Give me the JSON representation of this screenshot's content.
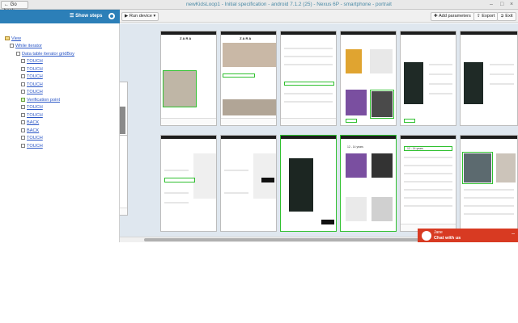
{
  "window": {
    "back_label": "Go back",
    "title": "newKidsLoop1 - Initial specification - android 7.1.2 (25) - Nexus 6P - smartphone - portrait"
  },
  "toolbar": {
    "show_steps_label": "Show steps",
    "run_device_label": "Run device",
    "add_parameters_label": "Add parameters",
    "export_label": "Export",
    "exit_label": "Exit"
  },
  "steps": [
    {
      "label": "View",
      "icon": "folder-icon"
    },
    {
      "label": "While iterator",
      "icon": "loop-icon"
    },
    {
      "label": "Data table iterator gridBoy",
      "icon": "table-icon"
    },
    {
      "label": "TOUCH",
      "icon": "touch-icon"
    },
    {
      "label": "TOUCH",
      "icon": "touch-icon"
    },
    {
      "label": "TOUCH",
      "icon": "touch-icon"
    },
    {
      "label": "TOUCH",
      "icon": "touch-icon"
    },
    {
      "label": "TOUCH",
      "icon": "touch-icon"
    },
    {
      "label": "Verification point",
      "icon": "check-icon"
    },
    {
      "label": "TOUCH",
      "icon": "touch-icon"
    },
    {
      "label": "TOUCH",
      "icon": "touch-icon"
    },
    {
      "label": "BACK",
      "icon": "back-icon"
    },
    {
      "label": "BACK",
      "icon": "back-icon"
    },
    {
      "label": "TOUCH",
      "icon": "touch-icon"
    },
    {
      "label": "TOUCH",
      "icon": "touch-icon"
    }
  ],
  "screens": {
    "brand": "ZARA",
    "size_label": "12 - 14 years"
  },
  "chat": {
    "agent_name": "Jane",
    "cta": "Chat with us"
  },
  "colors": {
    "accent_blue": "#2c7fb8",
    "highlight_green": "#2fc02f",
    "chat_red": "#d83a22"
  }
}
